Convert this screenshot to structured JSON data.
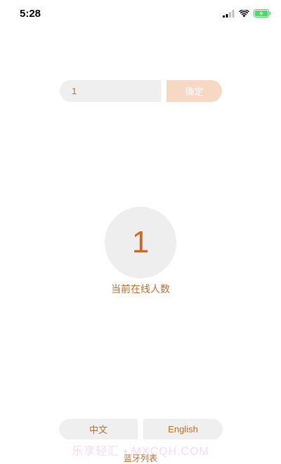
{
  "status_bar": {
    "time": "5:28",
    "icons": [
      "cellular-signal-icon",
      "wifi-icon",
      "battery-charging-icon"
    ],
    "battery_color": "#4cd964"
  },
  "input_row": {
    "value": "1",
    "confirm_label": "确定"
  },
  "online": {
    "count": "1",
    "label": "当前在线人数"
  },
  "language": {
    "chinese_label": "中文",
    "english_label": "English"
  },
  "watermark_text": "乐享轻汇 • MXCQH.COM",
  "bluetooth_list_label": "蓝牙列表",
  "colors": {
    "accent": "#c26b2e",
    "button_fill": "#f6d8c4",
    "surface": "#efefef"
  }
}
